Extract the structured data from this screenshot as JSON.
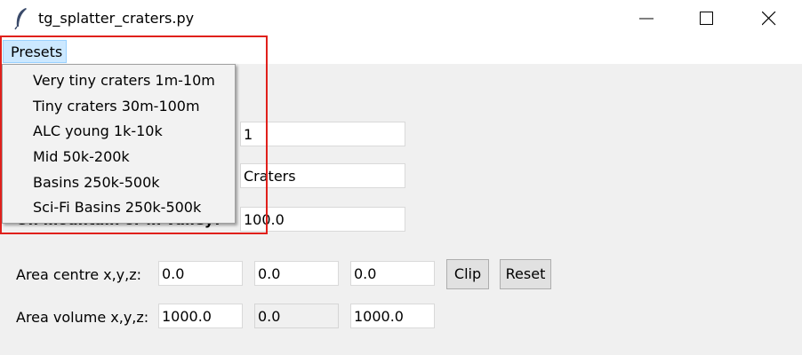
{
  "window": {
    "title": "tg_splatter_craters.py",
    "icon": "feather-icon",
    "controls": [
      "minimize-icon",
      "maximize-icon",
      "close-icon"
    ]
  },
  "menubar": {
    "presets_label": "Presets"
  },
  "presets_menu": {
    "items": [
      "Very tiny craters 1m-10m",
      "Tiny craters 30m-100m",
      "ALC young 1k-10k",
      "Mid 50k-200k",
      "Basins 250k-500k",
      "Sci-Fi Basins 250k-500k"
    ]
  },
  "fields": {
    "count_value": "1",
    "type_value": "Craters",
    "mountain_valley_label_partial": "On mountain or in valley?",
    "size_value": "100.0"
  },
  "area_centre": {
    "label": "Area centre x,y,z:",
    "x": "0.0",
    "y": "0.0",
    "z": "0.0",
    "clip_label": "Clip",
    "reset_label": "Reset"
  },
  "area_volume": {
    "label": "Area volume x,y,z:",
    "x": "1000.0",
    "y": "0.0",
    "z": "1000.0"
  },
  "colors": {
    "highlight_border": "#e0201b",
    "menu_active_bg": "#cce8ff",
    "window_bg": "#f0f0f0"
  }
}
